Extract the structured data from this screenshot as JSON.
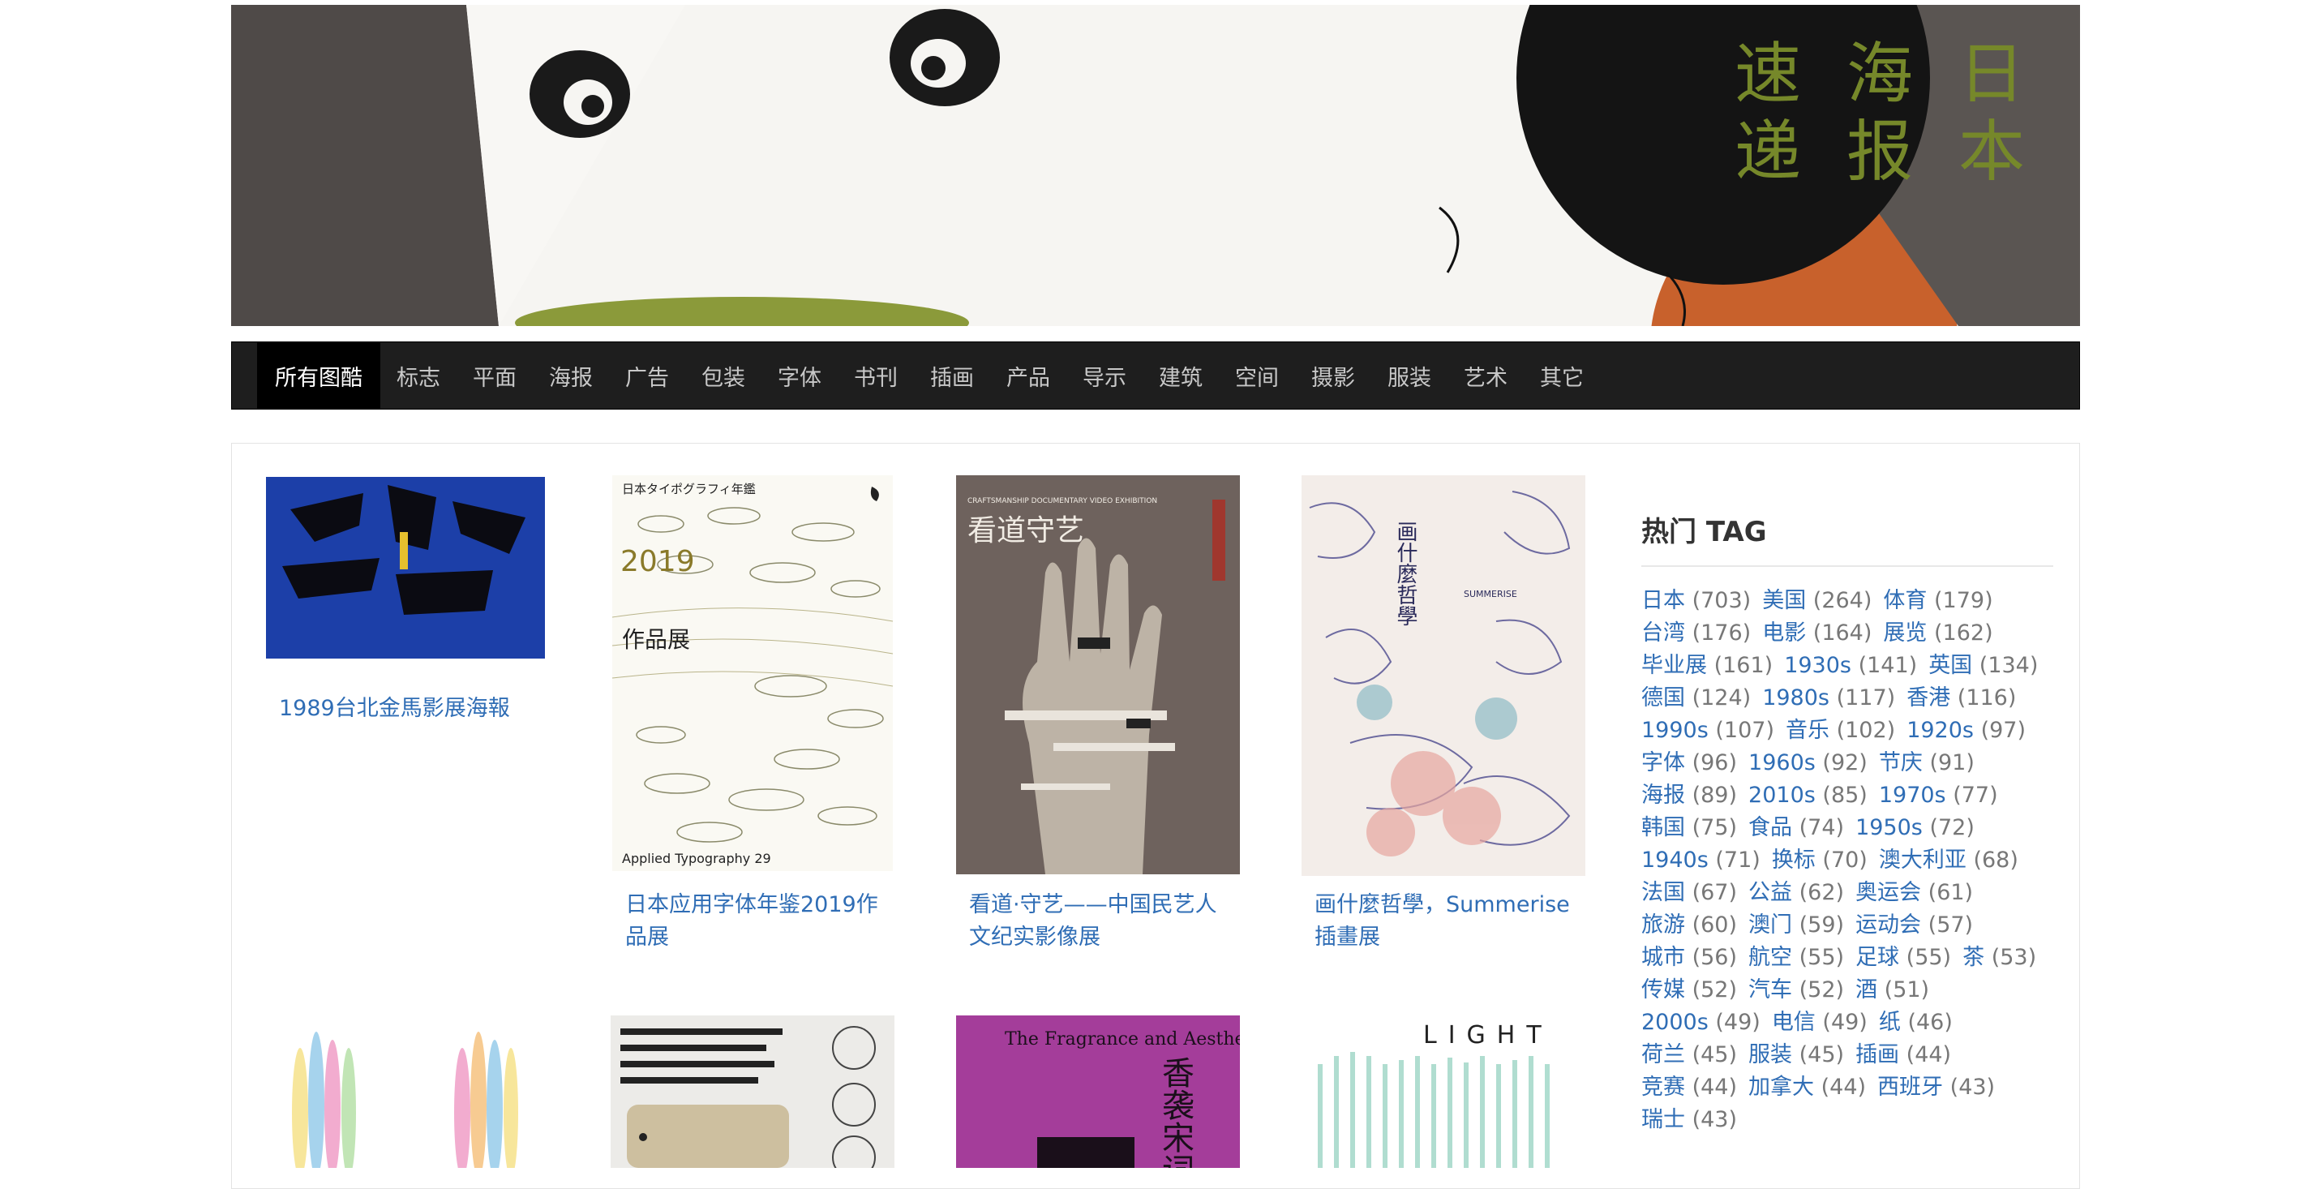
{
  "banner": {
    "title_columns": [
      [
        "日",
        "本"
      ],
      [
        "海",
        "报"
      ],
      [
        "速",
        "递"
      ]
    ],
    "accent_color": "#76882a"
  },
  "nav": {
    "items": [
      "所有图酷",
      "标志",
      "平面",
      "海报",
      "广告",
      "包装",
      "字体",
      "书刊",
      "插画",
      "产品",
      "导示",
      "建筑",
      "空间",
      "摄影",
      "服装",
      "艺术",
      "其它"
    ],
    "active_index": 0
  },
  "posts": [
    {
      "caption": "1989台北金馬影展海報"
    },
    {
      "caption": "日本应用字体年鉴2019作品展"
    },
    {
      "caption": "看道·守艺——中国民艺人文纪实影像展"
    },
    {
      "caption": "画什麼哲學，Summerise插畫展"
    }
  ],
  "posters": {
    "p2": {
      "header": "日本タイポグラフィ年鑑",
      "year": "2019",
      "title": "作品展",
      "footer": "Applied Typography 29"
    },
    "p3": {
      "title": "看道守艺",
      "sub": "CRAFTSMANSHIP DOCUMENTARY VIDEO EXHIBITION"
    },
    "p4": {
      "title": "画什麼哲學",
      "sub": "SUMMERISE"
    },
    "p7": {
      "title": "The Fragrance and Aesthetic Appreciation in the Life",
      "cn": "香袭宋词"
    },
    "p8": {
      "title": "LIGHT"
    }
  },
  "sidebar": {
    "title": "热门 TAG",
    "tag_lines": [
      [
        {
          "name": "日本",
          "count": "(703)"
        },
        {
          "name": "美国",
          "count": "(264)"
        },
        {
          "name": "体育",
          "count": "(179)"
        }
      ],
      [
        {
          "name": "台湾",
          "count": "(176)"
        },
        {
          "name": "电影",
          "count": "(164)"
        },
        {
          "name": "展览",
          "count": "(162)"
        }
      ],
      [
        {
          "name": "毕业展",
          "count": "(161)"
        },
        {
          "name": "1930s",
          "count": "(141)"
        },
        {
          "name": "英国",
          "count": "(134)"
        }
      ],
      [
        {
          "name": "德国",
          "count": "(124)"
        },
        {
          "name": "1980s",
          "count": "(117)"
        },
        {
          "name": "香港",
          "count": "(116)"
        }
      ],
      [
        {
          "name": "1990s",
          "count": "(107)"
        },
        {
          "name": "音乐",
          "count": "(102)"
        },
        {
          "name": "1920s",
          "count": "(97)"
        }
      ],
      [
        {
          "name": "字体",
          "count": "(96)"
        },
        {
          "name": "1960s",
          "count": "(92)"
        },
        {
          "name": "节庆",
          "count": "(91)"
        }
      ],
      [
        {
          "name": "海报",
          "count": "(89)"
        },
        {
          "name": "2010s",
          "count": "(85)"
        },
        {
          "name": "1970s",
          "count": "(77)"
        }
      ],
      [
        {
          "name": "韩国",
          "count": "(75)"
        },
        {
          "name": "食品",
          "count": "(74)"
        },
        {
          "name": "1950s",
          "count": "(72)"
        }
      ],
      [
        {
          "name": "1940s",
          "count": "(71)"
        },
        {
          "name": "换标",
          "count": "(70)"
        },
        {
          "name": "澳大利亚",
          "count": "(68)"
        }
      ],
      [
        {
          "name": "法国",
          "count": "(67)"
        },
        {
          "name": "公益",
          "count": "(62)"
        },
        {
          "name": "奥运会",
          "count": "(61)"
        }
      ],
      [
        {
          "name": "旅游",
          "count": "(60)"
        },
        {
          "name": "澳门",
          "count": "(59)"
        },
        {
          "name": "运动会",
          "count": "(57)"
        }
      ],
      [
        {
          "name": "城市",
          "count": "(56)"
        },
        {
          "name": "航空",
          "count": "(55)"
        },
        {
          "name": "足球",
          "count": "(55)"
        },
        {
          "name": "茶",
          "count": "(53)"
        }
      ],
      [
        {
          "name": "传媒",
          "count": "(52)"
        },
        {
          "name": "汽车",
          "count": "(52)"
        },
        {
          "name": "酒",
          "count": "(51)"
        }
      ],
      [
        {
          "name": "2000s",
          "count": "(49)"
        },
        {
          "name": "电信",
          "count": "(49)"
        },
        {
          "name": "纸",
          "count": "(46)"
        }
      ],
      [
        {
          "name": "荷兰",
          "count": "(45)"
        },
        {
          "name": "服装",
          "count": "(45)"
        },
        {
          "name": "插画",
          "count": "(44)"
        }
      ],
      [
        {
          "name": "竞赛",
          "count": "(44)"
        },
        {
          "name": "加拿大",
          "count": "(44)"
        },
        {
          "name": "西班牙",
          "count": "(43)"
        }
      ],
      [
        {
          "name": "瑞士",
          "count": "(43)"
        }
      ]
    ]
  }
}
